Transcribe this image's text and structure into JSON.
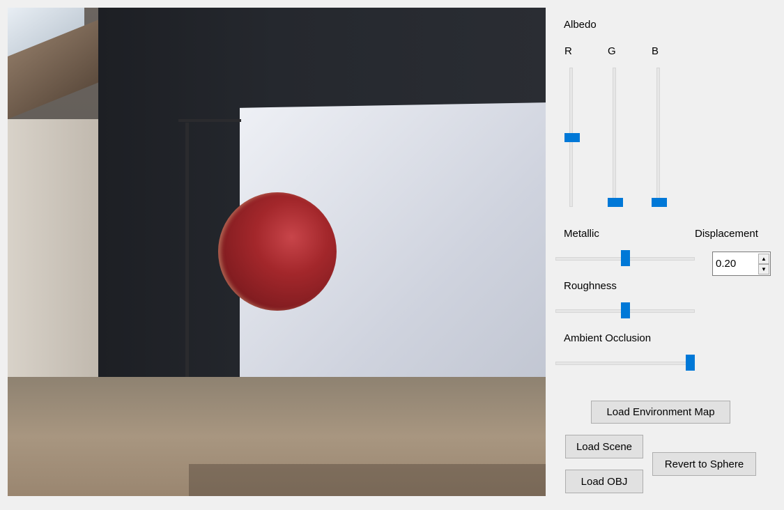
{
  "albedo": {
    "title": "Albedo",
    "channels": [
      {
        "label": "R",
        "value": 0.5
      },
      {
        "label": "G",
        "value": 0.0
      },
      {
        "label": "B",
        "value": 0.0
      }
    ]
  },
  "metallic": {
    "label": "Metallic",
    "value": 0.5
  },
  "roughness": {
    "label": "Roughness",
    "value": 0.5
  },
  "ambient_occlusion": {
    "label": "Ambient Occlusion",
    "value": 1.0
  },
  "displacement": {
    "label": "Displacement",
    "value": "0.20"
  },
  "buttons": {
    "load_env_map": "Load Environment Map",
    "load_scene": "Load Scene",
    "load_obj": "Load OBJ",
    "revert_sphere": "Revert to Sphere"
  },
  "spinner_icons": {
    "up": "arrow-up-icon",
    "down": "arrow-down-icon"
  },
  "colors": {
    "accent": "#0078d7",
    "sphere": "#a3272b"
  }
}
